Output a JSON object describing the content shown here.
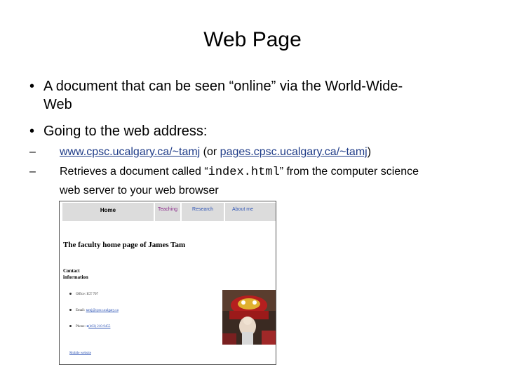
{
  "slide": {
    "title": "Web Page",
    "bullets": [
      "A document that can be seen “online” via the World-Wide-",
      "Web",
      "Going to the web address:"
    ],
    "sub1": {
      "dash": "–",
      "link1": "www.cpsc.ucalgary.ca/~tamj",
      "mid": " (or ",
      "link2": "pages.cpsc.ucalgary.ca/~tamj",
      "end": ")"
    },
    "sub2": {
      "dash": "–",
      "pre": "Retrieves a document called “",
      "code": "index.html",
      "post": "” from the computer science",
      "line2": "web server to your web browser"
    }
  },
  "screenshot": {
    "nav": [
      "Home",
      "Teaching",
      "Research",
      "About me"
    ],
    "heading": "The faculty home page of James Tam",
    "contact_line1": "Contact",
    "contact_line2": "information",
    "office_label": "Office: ICT 707",
    "email_label": "Email: ",
    "email_value": "tamj@cpsc.ucalgary.ca",
    "phone_label": "Phone: ",
    "phone_value": "(403) 210-9455",
    "mobile_link": "Mobile website"
  },
  "colors": {
    "link": "#1f3c88",
    "nav_bg": "#dcdcdc"
  }
}
